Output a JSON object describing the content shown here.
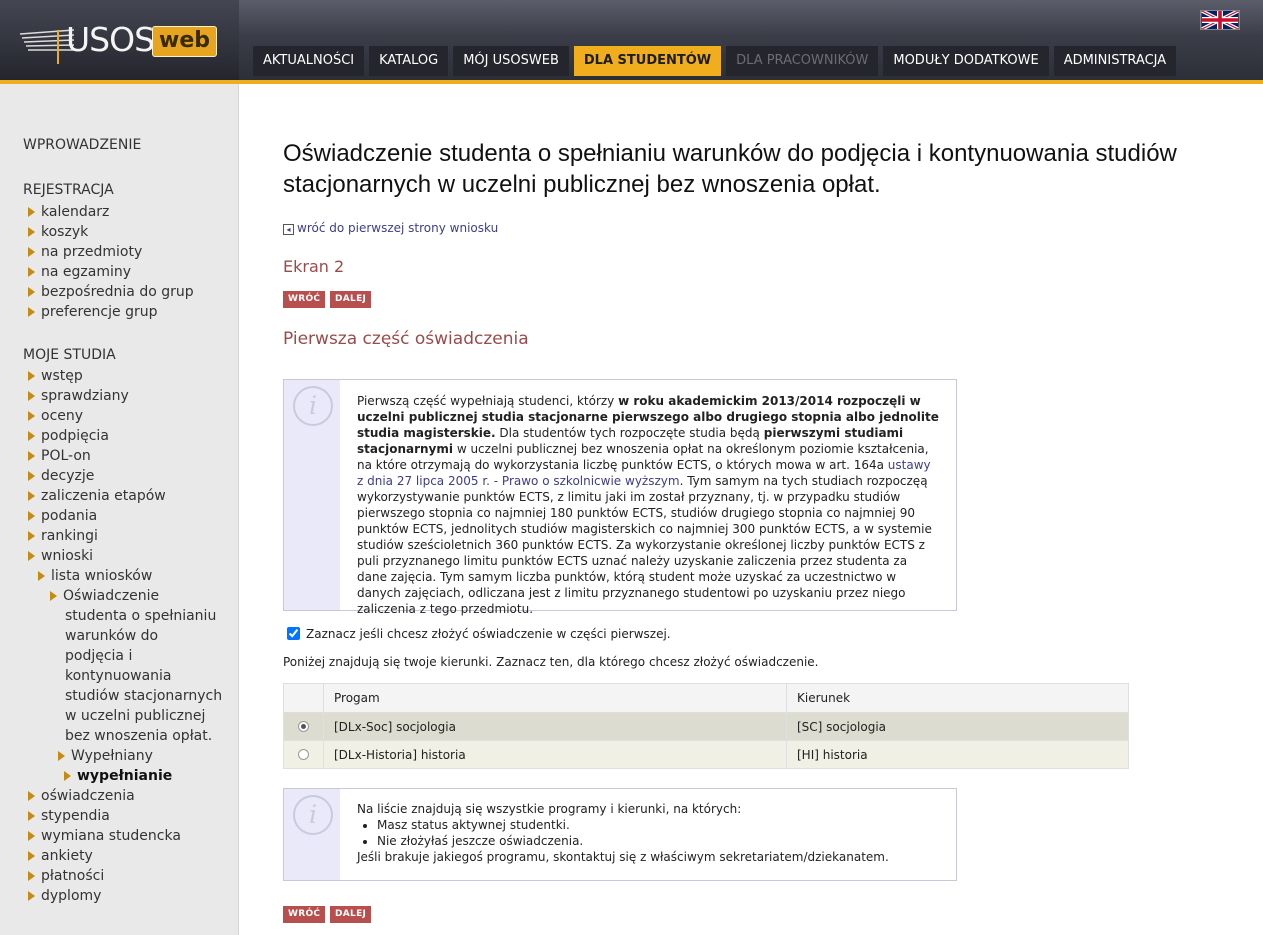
{
  "header": {
    "logo_text": "USOS",
    "logo_web": "web",
    "menu": [
      {
        "label": "AKTUALNOŚCI",
        "state": "normal"
      },
      {
        "label": "KATALOG",
        "state": "normal"
      },
      {
        "label": "MÓJ USOSWEB",
        "state": "normal"
      },
      {
        "label": "DLA STUDENTÓW",
        "state": "active"
      },
      {
        "label": "DLA PRACOWNIKÓW",
        "state": "disabled"
      },
      {
        "label": "MODUŁY DODATKOWE",
        "state": "normal"
      },
      {
        "label": "ADMINISTRACJA",
        "state": "normal"
      }
    ],
    "flag_icon": "uk-flag-icon"
  },
  "sidebar": {
    "sections": [
      "WPROWADZENIE",
      "REJESTRACJA",
      "MOJE STUDIA"
    ],
    "rejestracja": [
      "kalendarz",
      "koszyk",
      "na przedmioty",
      "na egzaminy",
      "bezpośrednia do grup",
      "preferencje grup"
    ],
    "moje_studia": [
      "wstęp",
      "sprawdziany",
      "oceny",
      "podpięcia",
      "POL-on",
      "decyzje",
      "zaliczenia etapów",
      "podania",
      "rankingi",
      "wnioski"
    ],
    "lista_wnioskow": "lista wniosków",
    "oswiadczenie_lines": [
      "Oświadczenie",
      "studenta o spełnianiu",
      "warunków do",
      "podjęcia i",
      "kontynuowania",
      "studiów stacjonarnych",
      "w uczelni publicznej",
      "bez wnoszenia opłat."
    ],
    "wypelniany": "Wypełniany",
    "wypelnianie": "wypełnianie",
    "after": [
      "oświadczenia",
      "stypendia",
      "wymiana studencka",
      "ankiety",
      "płatności",
      "dyplomy"
    ]
  },
  "main": {
    "title": "Oświadczenie studenta o spełnianiu warunków do podjęcia i kontynuowania studiów stacjonarnych w uczelni publicznej bez wnoszenia opłat.",
    "back_link": "wróć do pierwszej strony wniosku",
    "screen_title": "Ekran 2",
    "btn_back": "WRÓĆ",
    "btn_next": "DALEJ",
    "part_title": "Pierwsza część oświadczenia",
    "info1": {
      "p1": "Pierwszą część wypełniają studenci, którzy ",
      "b1": "w roku akademickim 2013/2014 rozpoczęli w uczelni publicznej studia stacjonarne pierwszego albo drugiego stopnia albo jednolite studia magisterskie.",
      "p2": " Dla studentów tych rozpoczęte studia będą ",
      "b2": "pierwszymi studiami stacjonarnymi",
      "p3": " w uczelni publicznej bez wnoszenia opłat na określonym poziomie kształcenia, na które otrzymają do wykorzystania liczbę punktów ECTS, o których mowa w art. 164a ",
      "link": "ustawy z dnia 27 lipca 2005 r. - Prawo o szkolnicwie wyższym",
      "p4": ". Tym samym na tych studiach rozpoczęą wykorzystywanie punktów ECTS, z limitu jaki im został przyznany, tj. w przypadku studiów pierwszego stopnia co najmniej 180 punktów ECTS, studiów drugiego stopnia co najmniej 90 punktów ECTS, jednolitych studiów magisterskich co najmniej 300 punktów ECTS, a w systemie studiów sześcioletnich 360 punktów ECTS. Za wykorzystanie określonej liczby punktów ECTS z puli przyznanego limitu punktów ECTS uznać należy uzyskanie zaliczenia przez studenta za dane zajęcia. Tym samym liczba punktów, którą student może uzyskać za uczestnictwo w danych zajęciach, odliczana jest z limitu przyznanego studentowi po uzyskaniu przez niego zaliczenia z tego przedmiotu."
    },
    "checkbox_label": "Zaznacz jeśli chcesz złożyć oświadczenie w części pierwszej.",
    "checkbox_checked": true,
    "directions_text": "Poniżej znajdują się twoje kierunki. Zaznacz ten, dla którego chcesz złożyć oświadczenie.",
    "table": {
      "headers": [
        "Progam",
        "Kierunek"
      ],
      "rows": [
        {
          "program": "[DLx-Soc] socjologia",
          "kierunek": "[SC] socjologia",
          "selected": true
        },
        {
          "program": "[DLx-Historia] historia",
          "kierunek": "[HI] historia",
          "selected": false
        }
      ]
    },
    "info2": {
      "intro": "Na liście znajdują się wszystkie programy i kierunki, na których:",
      "items": [
        "Masz status aktywnej studentki.",
        "Nie złożyłaś jeszcze oświadczenia."
      ],
      "outro": "Jeśli brakuje jakiegoś programu, skontaktuj się z właściwym sekretariatem/dziekanatem."
    }
  }
}
